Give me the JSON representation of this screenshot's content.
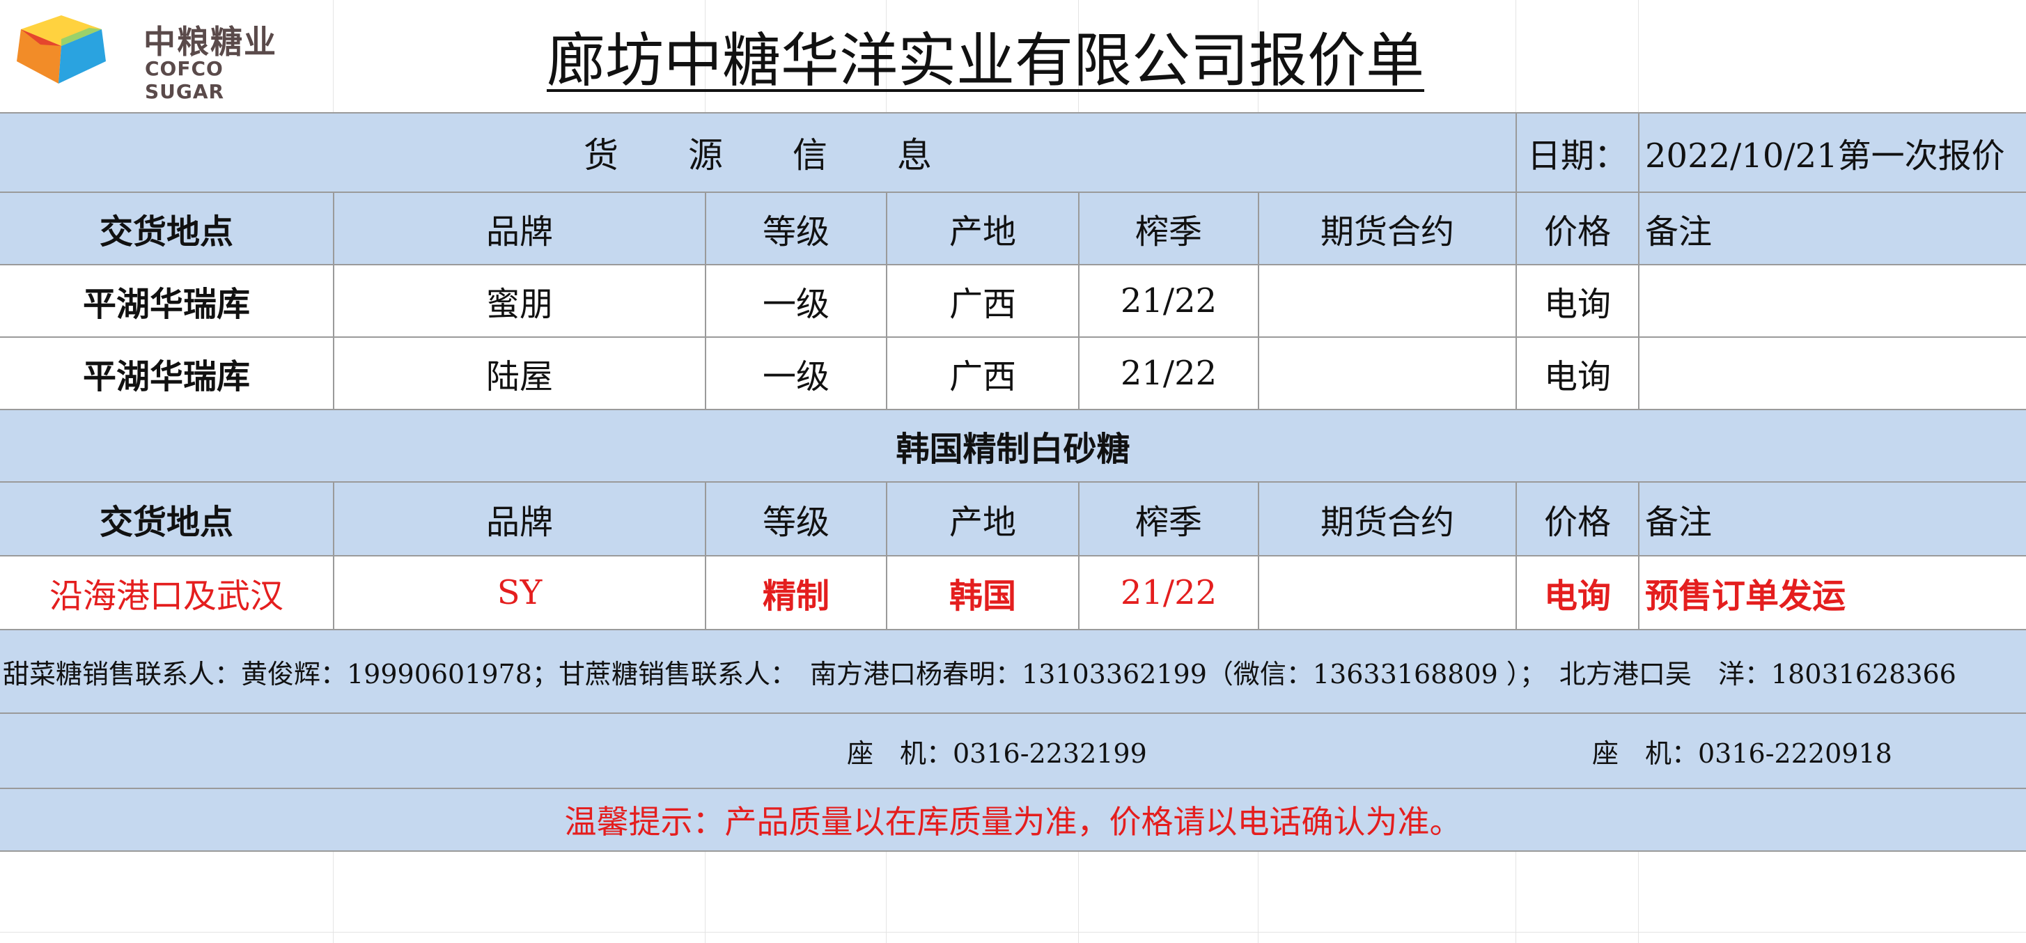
{
  "logo": {
    "name_cn": "中粮糖业",
    "name_en": "COFCO SUGAR"
  },
  "title": "廊坊中糖华洋实业有限公司报价单",
  "source_header": {
    "label": "货　　源　　信　　息",
    "date_label": "日期：",
    "date_value": "2022/10/21第一次报价"
  },
  "columns": [
    "交货地点",
    "品牌",
    "等级",
    "产地",
    "榨季",
    "期货合约",
    "价格",
    "备注"
  ],
  "rows_section1": [
    {
      "location": "平湖华瑞库",
      "brand": "蜜朋",
      "grade": "一级",
      "origin": "广西",
      "season": "21/22",
      "futures": "",
      "price": "电询",
      "note": ""
    },
    {
      "location": "平湖华瑞库",
      "brand": "陆屋",
      "grade": "一级",
      "origin": "广西",
      "season": "21/22",
      "futures": "",
      "price": "电询",
      "note": ""
    }
  ],
  "section2_title": "韩国精制白砂糖",
  "rows_section2": [
    {
      "location": "沿海港口及武汉",
      "brand": "SY",
      "grade": "精制",
      "origin": "韩国",
      "season": "21/22",
      "futures": "",
      "price": "电询",
      "note": "预售订单发运"
    }
  ],
  "contact": {
    "line1": "甜菜糖销售联系人：黄俊辉：19990601978；甘蔗糖销售联系人：　南方港口杨春明：13103362199（微信：13633168809 ）；　北方港口吴　洋：18031628366",
    "landline_south": "座　机：0316-2232199",
    "landline_north": "座　机：0316-2220918"
  },
  "notice": "温馨提示：产品质量以在库质量为准，价格请以电话确认为准。",
  "colors": {
    "header_fill": "#c5d8ef",
    "highlight_red": "#e41e1e"
  }
}
